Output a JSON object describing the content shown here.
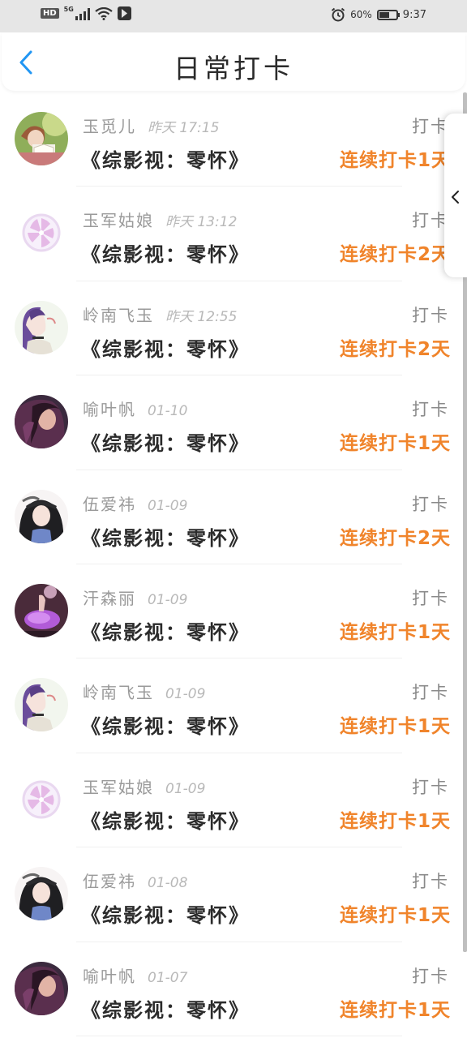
{
  "status_bar": {
    "hd": "HD",
    "network": "5G",
    "battery": "60%",
    "battery_level": 0.6,
    "time": "9:37"
  },
  "header": {
    "title": "日常打卡",
    "back_icon": "chevron-left-icon"
  },
  "colors": {
    "accent_orange": "#f0842b",
    "back_blue": "#2196f3"
  },
  "list": [
    {
      "name": "玉觅儿",
      "date": "昨天 17:15",
      "task": "《综影视：零怀》",
      "action": "打卡",
      "streak": "连续打卡1天",
      "avatar": "girl-reading-photo"
    },
    {
      "name": "玉军姑娘",
      "date": "昨天 13:12",
      "task": "《综影视：零怀》",
      "action": "打卡",
      "streak": "连续打卡2天",
      "avatar": "citrus-slice-photo"
    },
    {
      "name": "岭南飞玉",
      "date": "昨天 12:55",
      "task": "《综影视：零怀》",
      "action": "打卡",
      "streak": "连续打卡2天",
      "avatar": "anime-girl-purple-hair"
    },
    {
      "name": "喻叶帆",
      "date": "01-10",
      "task": "《综影视：零怀》",
      "action": "打卡",
      "streak": "连续打卡1天",
      "avatar": "dark-hair-girl-photo"
    },
    {
      "name": "伍爱祎",
      "date": "01-09",
      "task": "《综影视：零怀》",
      "action": "打卡",
      "streak": "连续打卡2天",
      "avatar": "anime-girl-black-hair"
    },
    {
      "name": "汗森丽",
      "date": "01-09",
      "task": "《综影视：零怀》",
      "action": "打卡",
      "streak": "连续打卡1天",
      "avatar": "purple-dress-photo"
    },
    {
      "name": "岭南飞玉",
      "date": "01-09",
      "task": "《综影视：零怀》",
      "action": "打卡",
      "streak": "连续打卡1天",
      "avatar": "anime-girl-purple-hair"
    },
    {
      "name": "玉军姑娘",
      "date": "01-09",
      "task": "《综影视：零怀》",
      "action": "打卡",
      "streak": "连续打卡1天",
      "avatar": "citrus-slice-photo"
    },
    {
      "name": "伍爱祎",
      "date": "01-08",
      "task": "《综影视：零怀》",
      "action": "打卡",
      "streak": "连续打卡1天",
      "avatar": "anime-girl-black-hair"
    },
    {
      "name": "喻叶帆",
      "date": "01-07",
      "task": "《综影视：零怀》",
      "action": "打卡",
      "streak": "连续打卡1天",
      "avatar": "dark-hair-girl-photo"
    }
  ],
  "side_tab": {
    "icon": "chevron-left-icon"
  }
}
